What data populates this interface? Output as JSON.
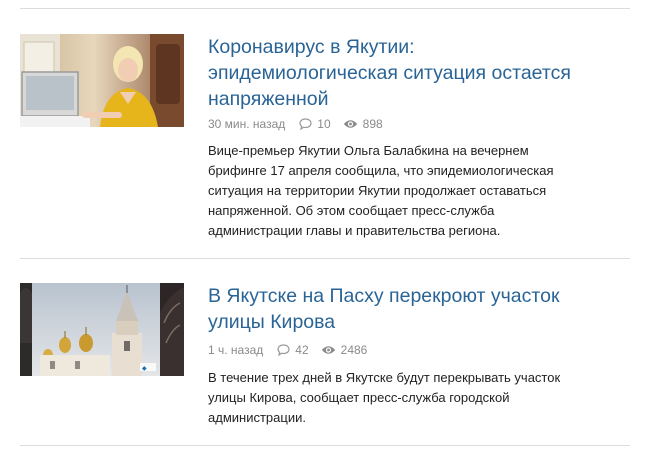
{
  "colors": {
    "title": "#2a6496",
    "meta": "#8a8a8a",
    "text": "#222222",
    "divider": "#dcdcdc"
  },
  "articles": [
    {
      "title_lines": [
        "Коронавирус в Якутии:",
        "эпидемиологическая ситуация остается",
        "напряженной"
      ],
      "time": "30 мин. назад",
      "comments": "10",
      "views": "898",
      "summary_lines": [
        "Вице-премьер Якутии Ольга Балабкина на вечернем",
        "брифинге 17 апреля сообщила, что эпидемиологическая",
        "ситуация на территории Якутии продолжает оставаться",
        "напряженной. Об этом сообщает пресс-служба",
        "администрации главы и правительства региона."
      ],
      "image_icon": "woman-at-computer-photo"
    },
    {
      "title_lines": [
        "В Якутске на Пасху перекроют участок",
        "улицы Кирова"
      ],
      "time": "1 ч. назад",
      "comments": "42",
      "views": "2486",
      "summary_lines": [
        "В течение трех дней в Якутске будут перекрывать участок",
        "улицы Кирова, сообщает пресс-служба городской",
        "администрации."
      ],
      "image_icon": "church-domes-photo"
    }
  ],
  "icons": {
    "comment": "speech-bubble-icon",
    "views": "eye-icon"
  }
}
